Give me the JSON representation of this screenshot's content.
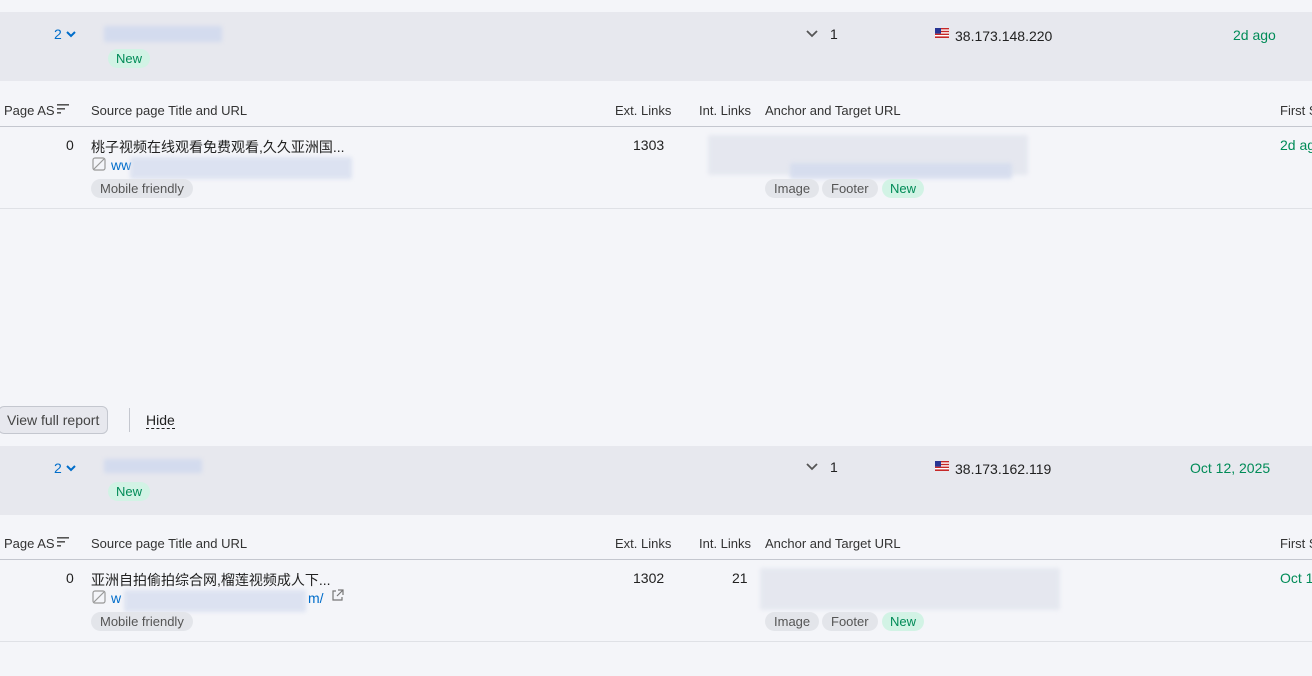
{
  "groups": [
    {
      "count": "2",
      "badge": "New",
      "links_count": "1",
      "ip": "38.173.148.220",
      "date": "2d ago",
      "table": {
        "headers": [
          "Page AS",
          "Source page Title and URL",
          "Ext. Links",
          "Int. Links",
          "Anchor and Target URL",
          "First S"
        ],
        "row": {
          "page_as": "0",
          "title": "桃子视频在线观看免费观看,久久亚洲国...",
          "url_prefix": "ww",
          "url_suffix": "",
          "chip": "Mobile friendly",
          "ext_links": "1303",
          "int_links": "",
          "anchor_chips": [
            "Image",
            "Footer"
          ],
          "anchor_badge": "New",
          "first_seen": "2d ag"
        }
      }
    },
    {
      "count": "2",
      "badge": "New",
      "links_count": "1",
      "ip": "38.173.162.119",
      "date": "Oct 12, 2025",
      "table": {
        "headers": [
          "Page AS",
          "Source page Title and URL",
          "Ext. Links",
          "Int. Links",
          "Anchor and Target URL",
          "First S"
        ],
        "row": {
          "page_as": "0",
          "title": "亚洲自拍偷拍综合网,榴莲视频成人下...",
          "url_prefix": "w",
          "url_suffix": "m/",
          "chip": "Mobile friendly",
          "ext_links": "1302",
          "int_links": "21",
          "anchor_chips": [
            "Image",
            "Footer"
          ],
          "anchor_badge": "New",
          "first_seen": "Oct 1"
        }
      }
    }
  ],
  "actions": {
    "view_full_report": "View full report",
    "hide": "Hide"
  },
  "colors": {
    "accent_blue": "#006dca",
    "green": "#008b57",
    "badge_bg": "#d2f3e5"
  }
}
